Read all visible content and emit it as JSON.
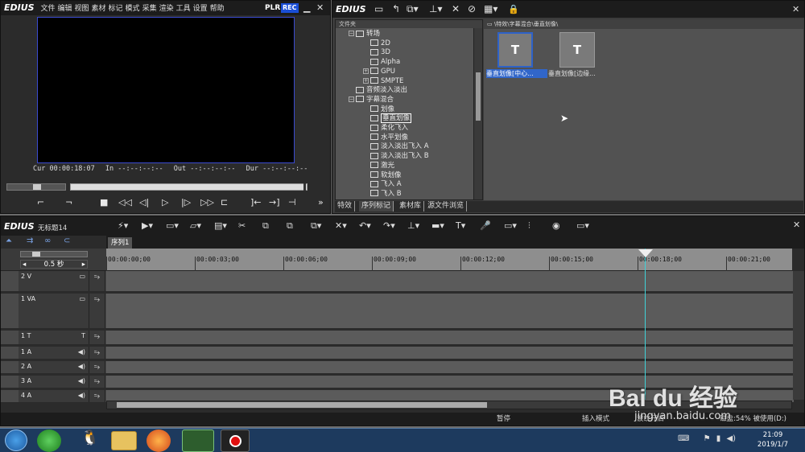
{
  "player": {
    "logo": "EDIUS",
    "menu": [
      "文件",
      "编辑",
      "视图",
      "素材",
      "标记",
      "模式",
      "采集",
      "渲染",
      "工具",
      "设置",
      "帮助"
    ],
    "plr": "PLR",
    "rec": "REC",
    "timecodes": {
      "cur_label": "Cur",
      "cur": "00:00:18:07",
      "in_label": "In",
      "in": "--:--:--:--",
      "out_label": "Out",
      "out": "--:--:--:--",
      "dur_label": "Dur",
      "dur": "--:--:--:--"
    }
  },
  "effects": {
    "logo": "EDIUS",
    "folder_header": "文件夹",
    "path": "\\特效\\字幕混合\\垂直划像\\",
    "tree": [
      {
        "label": "转场",
        "level": 0,
        "expand": "−",
        "icon": "folder"
      },
      {
        "label": "2D",
        "level": 1,
        "icon": "fx"
      },
      {
        "label": "3D",
        "level": 1,
        "icon": "fx"
      },
      {
        "label": "Alpha",
        "level": 1,
        "icon": "fx"
      },
      {
        "label": "GPU",
        "level": 1,
        "expand": "+",
        "icon": "fx"
      },
      {
        "label": "SMPTE",
        "level": 1,
        "expand": "+",
        "icon": "fx"
      },
      {
        "label": "音频淡入淡出",
        "level": 0,
        "icon": "fx"
      },
      {
        "label": "字幕混合",
        "level": 0,
        "expand": "−",
        "icon": "folder"
      },
      {
        "label": "划像",
        "level": 1,
        "icon": "fx"
      },
      {
        "label": "垂直划像",
        "level": 1,
        "icon": "fx",
        "selected": true
      },
      {
        "label": "柔化飞入",
        "level": 1,
        "icon": "fx"
      },
      {
        "label": "水平划像",
        "level": 1,
        "icon": "fx"
      },
      {
        "label": "淡入淡出飞入 A",
        "level": 1,
        "icon": "fx"
      },
      {
        "label": "淡入淡出飞入 B",
        "level": 1,
        "icon": "fx"
      },
      {
        "label": "激光",
        "level": 1,
        "icon": "fx"
      },
      {
        "label": "软划像",
        "level": 1,
        "icon": "fx"
      },
      {
        "label": "飞入 A",
        "level": 1,
        "icon": "fx"
      },
      {
        "label": "飞入 B",
        "level": 1,
        "icon": "fx"
      }
    ],
    "items": [
      {
        "label": "垂直划像[中心..."
      },
      {
        "label": "垂直划像[边缘..."
      }
    ],
    "tabs": [
      "特效",
      "序列标记",
      "素材库",
      "源文件浏览"
    ]
  },
  "timeline": {
    "logo": "EDIUS",
    "project": "无标题14",
    "sequence_tab": "序列1",
    "zoom": "0.5 秒",
    "ruler": [
      "00:00:00;00",
      "00:00:03;00",
      "00:00:06;00",
      "00:00:09;00",
      "00:00:12;00",
      "00:00:15;00",
      "00:00:18;00",
      "00:00:21;00"
    ],
    "tracks": [
      {
        "label": "2 V"
      },
      {
        "label": "1 VA"
      },
      {
        "label": "1 T"
      },
      {
        "label": "1 A"
      },
      {
        "label": "2 A"
      },
      {
        "label": "3 A"
      },
      {
        "label": "4 A"
      }
    ]
  },
  "status": {
    "pause": "暂停",
    "insert": "插入模式",
    "ripple": "波纹开启",
    "disk": "磁盘:54% 被使用(D:)"
  },
  "taskbar": {
    "time": "21:09",
    "date": "2019/1/7"
  },
  "watermark": {
    "brand": "Bai du 经验",
    "url": "jingyan.baidu.com"
  },
  "colors": {
    "rec": "#1a4fd6",
    "selected": "#3166c9",
    "playhead": "#3fd2d8"
  }
}
